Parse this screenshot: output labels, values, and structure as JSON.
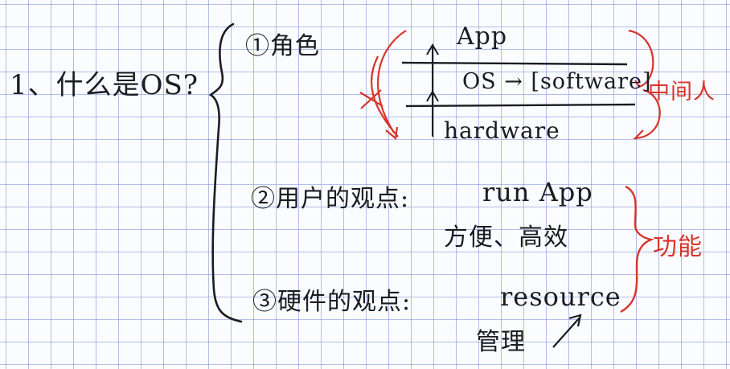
{
  "notes": {
    "question": "1、什么是OS?",
    "role": {
      "marker": "①角色",
      "layers": [
        "App",
        "OS → [software]",
        "hardware"
      ],
      "side_label": "中间人"
    },
    "user_view": {
      "marker": "②用户的观点:",
      "text": "run App",
      "subtext": "方便、高效"
    },
    "hardware_view": {
      "marker": "③硬件的观点:",
      "text": "resource",
      "subtext": "管理"
    },
    "function_label": "功能",
    "colors": {
      "ink": "#1b1b22",
      "red_ink": "#d8342b",
      "grid": "#7a8cd2",
      "paper": "#fbfcff"
    }
  }
}
